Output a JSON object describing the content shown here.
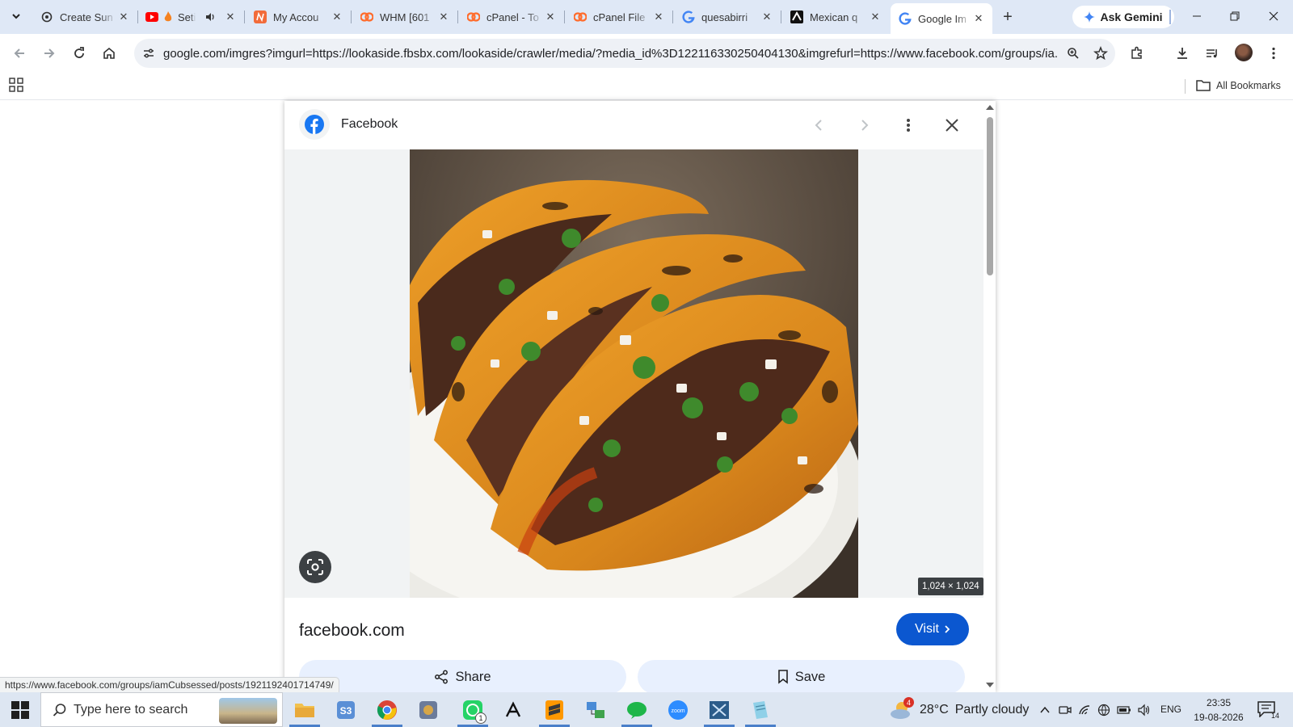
{
  "browser": {
    "tabs": [
      {
        "title": "Create Sun",
        "icon": "openai-icon",
        "active": false
      },
      {
        "title": "Seti",
        "icon": "youtube-icon",
        "active": false
      },
      {
        "title": "My Accou",
        "icon": "account-icon",
        "active": false
      },
      {
        "title": "WHM [601",
        "icon": "cpanel-icon",
        "active": false
      },
      {
        "title": "cPanel - To",
        "icon": "cpanel-icon",
        "active": false
      },
      {
        "title": "cPanel File",
        "icon": "cpanel-icon",
        "active": false
      },
      {
        "title": "quesabirri",
        "icon": "google-icon",
        "active": false
      },
      {
        "title": "Mexican q",
        "icon": "medium-icon",
        "active": false
      },
      {
        "title": "Google Im",
        "icon": "google-icon",
        "active": true
      }
    ],
    "ask_gemini_label": "Ask Gemini",
    "url": "google.com/imgres?imgurl=https://lookaside.fbsbx.com/lookaside/crawler/media/?media_id%3D122116330250404130&imgrefurl=https://www.facebook.com/groups/ia...",
    "bookmarks": {
      "all_label": "All Bookmarks"
    },
    "status_url": "https://www.facebook.com/groups/iamCubsessed/posts/1921192401714749/"
  },
  "viewer": {
    "source_name": "Facebook",
    "domain": "facebook.com",
    "dimensions": "1,024 × 1,024",
    "visit_label": "Visit",
    "share_label": "Share",
    "save_label": "Save"
  },
  "taskbar": {
    "search_placeholder": "Type here to search",
    "weather_temp": "28°C",
    "weather_text": "Partly cloudy",
    "language": "ENG",
    "time": "23:35",
    "date": "19-08-2026",
    "weather_badge": "4",
    "whatsapp_badge": "1",
    "notification_count": "14"
  },
  "colors": {
    "accent": "#0b57d0",
    "tabstrip": "#dfe8f6",
    "facebook": "#1877f2"
  }
}
